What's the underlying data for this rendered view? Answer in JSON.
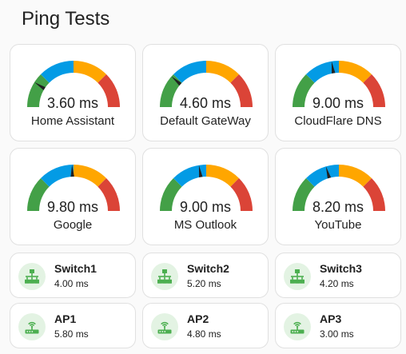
{
  "page": {
    "title": "Ping Tests"
  },
  "gauge_style": {
    "min": 0,
    "max": 20,
    "segment_colors": [
      "#43a047",
      "#039be5",
      "#ffa600",
      "#db4437"
    ],
    "needle_color": "#212121"
  },
  "gauges": [
    {
      "label": "3.60 ms",
      "name": "Home Assistant",
      "value": 3.6
    },
    {
      "label": "4.60 ms",
      "name": "Default GateWay",
      "value": 4.6
    },
    {
      "label": "9.00 ms",
      "name": "CloudFlare DNS",
      "value": 9.0
    },
    {
      "label": "9.80 ms",
      "name": "Google",
      "value": 9.8
    },
    {
      "label": "9.00 ms",
      "name": "MS Outlook",
      "value": 9.0
    },
    {
      "label": "8.20 ms",
      "name": "YouTube",
      "value": 8.2
    }
  ],
  "entities": [
    {
      "name": "Switch1",
      "value": "4.00 ms",
      "icon": "switch-network-icon"
    },
    {
      "name": "Switch2",
      "value": "5.20 ms",
      "icon": "switch-network-icon"
    },
    {
      "name": "Switch3",
      "value": "4.20 ms",
      "icon": "switch-network-icon"
    },
    {
      "name": "AP1",
      "value": "5.80 ms",
      "icon": "access-point-icon"
    },
    {
      "name": "AP2",
      "value": "4.80 ms",
      "icon": "access-point-icon"
    },
    {
      "name": "AP3",
      "value": "3.00 ms",
      "icon": "access-point-icon"
    }
  ],
  "icon_color": "#4caf50"
}
